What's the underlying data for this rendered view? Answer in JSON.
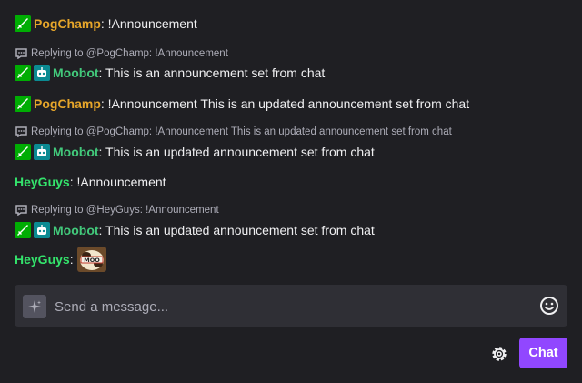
{
  "colors": {
    "pogchamp": "#e7a62a",
    "moobot": "#42c97b",
    "heyguys": "#34e46c",
    "accent": "#9147ff"
  },
  "messages": [
    {
      "badges": [
        "sword-icon"
      ],
      "username": "PogChamp",
      "text": ": !Announcement"
    },
    {
      "reply": "Replying to @PogChamp: !Announcement",
      "badges": [
        "sword-icon",
        "robot-icon"
      ],
      "username": "Moobot",
      "text": ": This is an announcement set from chat"
    },
    {
      "badges": [
        "sword-icon"
      ],
      "username": "PogChamp",
      "text": ": !Announcement This is an updated announcement set from chat"
    },
    {
      "reply": "Replying to @PogChamp: !Announcement This is an updated announcement set from chat",
      "badges": [
        "sword-icon",
        "robot-icon"
      ],
      "username": "Moobot",
      "text": ": This is an updated announcement set from chat"
    },
    {
      "username": "HeyGuys",
      "text": ": !Announcement"
    },
    {
      "reply": "Replying to @HeyGuys: !Announcement",
      "badges": [
        "sword-icon",
        "robot-icon"
      ],
      "username": "Moobot",
      "text": ": This is an updated announcement set from chat"
    },
    {
      "username": "HeyGuys",
      "text": ":",
      "emote": "moo-emote-icon"
    }
  ],
  "composer": {
    "placeholder": "Send a message...",
    "chat_label": "Chat"
  }
}
